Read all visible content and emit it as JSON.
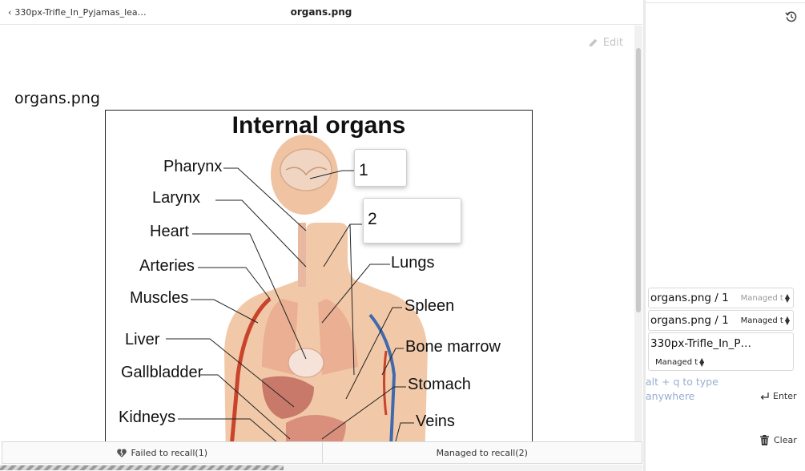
{
  "topbar": {
    "back_label": "330px-Trifle_In_Pyjamas_lea…",
    "title": "organs.png"
  },
  "content": {
    "edit_label": "Edit",
    "card_title": "organs.png",
    "diagram": {
      "title": "Internal organs",
      "labels": {
        "pharynx": "Pharynx",
        "larynx": "Larynx",
        "heart": "Heart",
        "arteries": "Arteries",
        "muscles": "Muscles",
        "liver": "Liver",
        "gallbladder": "Gallbladder",
        "kidneys": "Kidneys",
        "lungs": "Lungs",
        "spleen": "Spleen",
        "bone_marrow": "Bone marrow",
        "stomach": "Stomach",
        "veins": "Veins"
      },
      "occlusions": [
        "1",
        "2"
      ]
    }
  },
  "answer_bar": {
    "failed_label": "Failed to recall(1)",
    "managed_label": "Managed to recall(2)"
  },
  "history": {
    "items": [
      {
        "name": "organs.png / 1",
        "status": "Managed t"
      },
      {
        "name": "organs.png / 1",
        "status": "Managed t"
      },
      {
        "name": "330px-Trifle_In_P…",
        "status": "Managed t"
      }
    ],
    "hint_line1": "alt + q to type",
    "hint_line2": "anywhere",
    "enter_label": "Enter",
    "clear_label": "Clear"
  },
  "icons": {
    "back": "chevron-left-icon",
    "edit": "pencil-icon",
    "history": "history-icon",
    "failed": "broken-heart-icon",
    "enter": "enter-arrow-icon",
    "clear": "trash-icon"
  },
  "colors": {
    "hint": "#9aaed0",
    "body_skin": "#f2c9a8",
    "artery": "#c8442c",
    "vein": "#3f6ab0"
  }
}
